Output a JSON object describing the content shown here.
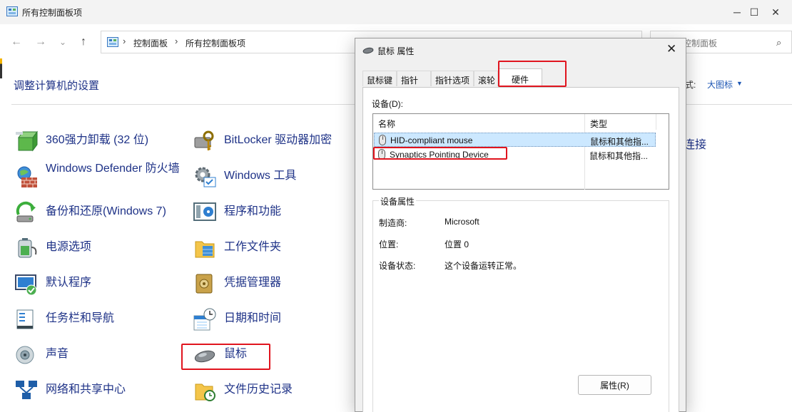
{
  "window": {
    "title": "所有控制面板项"
  },
  "window_controls": {
    "minimize": "─",
    "maximize": "☐",
    "close": "✕"
  },
  "nav": {
    "back": "←",
    "forward": "→",
    "recent": "⌄",
    "up": "↑"
  },
  "address": {
    "sep": "›",
    "crumbs": [
      "控制面板",
      "所有控制面板项"
    ]
  },
  "search": {
    "placeholder": "搜索控制面板",
    "placeholder_visible": "控制面板",
    "icon": "⌕"
  },
  "page": {
    "heading": "调整计算机的设置",
    "view_label": "式:",
    "view_value": "大图标",
    "view_arrow": "▼"
  },
  "items_left": [
    "360强力卸载 (32 位)",
    "Windows Defender 防火墙",
    "备份和还原(Windows 7)",
    "电源选项",
    "默认程序",
    "任务栏和导航",
    "声音",
    "网络和共享中心"
  ],
  "items_mid": [
    "BitLocker 驱动器加密",
    "Windows 工具",
    "程序和功能",
    "工作文件夹",
    "凭据管理器",
    "日期和时间",
    "鼠标",
    "文件历史记录"
  ],
  "items_right": [
    "连接"
  ],
  "dialog": {
    "title": "鼠标 属性",
    "close": "✕",
    "tabs": [
      "鼠标键",
      "指针",
      "指针选项",
      "滚轮",
      "硬件"
    ],
    "devices_label": "设备(D):",
    "columns": [
      "名称",
      "类型"
    ],
    "devices": [
      {
        "name": "HID-compliant mouse",
        "type": "鼠标和其他指..."
      },
      {
        "name": "Synaptics Pointing Device",
        "type": "鼠标和其他指..."
      }
    ],
    "props_title": "设备属性",
    "props": [
      {
        "key": "制造商:",
        "value": "Microsoft"
      },
      {
        "key": "位置:",
        "value": "位置 0"
      },
      {
        "key": "设备状态:",
        "value": "这个设备运转正常。"
      }
    ],
    "props_button": "属性(R)"
  },
  "colors": {
    "link": "#1e3287",
    "accent_select": "#cce8ff",
    "highlight": "#e0141e"
  }
}
